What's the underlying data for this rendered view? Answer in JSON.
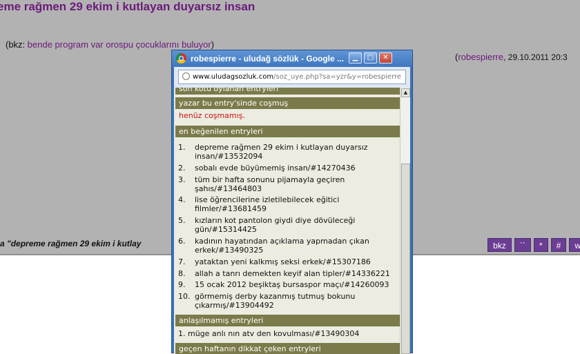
{
  "page": {
    "entry_title": "eme rağmen 29 ekim i kutlayan duyarsız insan",
    "bkz_open": "(bkz: ",
    "bkz_link": "bende program var orospu çocuklarını buluyor",
    "bkz_close": ")",
    "author_open": "(",
    "author": "robespierre",
    "author_date": ", 29.10.2011 20:3",
    "quote_fragment": "a \"depreme rağmen 29 ekim i kutlay",
    "buttons": [
      {
        "label": "bkz"
      },
      {
        "label": "``"
      },
      {
        "label": "*"
      },
      {
        "label": "#"
      },
      {
        "label": "ww"
      }
    ]
  },
  "popup": {
    "title": "robespierre - uludağ sözlük - Google ...",
    "url_host": "www.uludagsozluk.com",
    "url_path": "/soz_uye.php?sa=yzr&y=robespierre",
    "sections": {
      "cut_top": "son kötü oylanan entryleri",
      "cosmus": "yazar bu entry'sinde coşmuş",
      "cosmus_empty": "henüz coşmamış.",
      "liked": "en beğenilen entryleri",
      "unliked": "anlaşılmamış entryleri",
      "unliked_item": "1. müge anlı nın atv den kovulması/#13490304",
      "cut_bottom": "geçen haftanın dikkat çeken entryleri"
    },
    "liked_entries": [
      {
        "num": "1.",
        "line1": "depreme rağmen 29 ekim i kutlayan duyarsız",
        "line2": "insan/#13532094"
      },
      {
        "num": "2.",
        "line1": "sobalı evde büyümemiş insan/#14270436",
        "line2": ""
      },
      {
        "num": "3.",
        "line1": "tüm bir hafta sonunu pijamayla geçiren",
        "line2": "şahıs/#13464803"
      },
      {
        "num": "4.",
        "line1": "lise öğrencilerine izletilebilecek eğitici",
        "line2": "filmler/#13681459"
      },
      {
        "num": "5.",
        "line1": "kızların kot pantolon giydi diye dövüleceği",
        "line2": "gün/#15314425"
      },
      {
        "num": "6.",
        "line1": "kadının hayatından açıklama yapmadan çıkan",
        "line2": "erkek/#13490325"
      },
      {
        "num": "7.",
        "line1": "yataktan yeni kalkmış seksi erkek/#15307186",
        "line2": ""
      },
      {
        "num": "8.",
        "line1": "allah a tanrı demekten keyif alan tipler/#14336221",
        "line2": ""
      },
      {
        "num": "9.",
        "line1": "15 ocak 2012 beşiktaş bursaspor maçı/#14260093",
        "line2": ""
      },
      {
        "num": "10.",
        "line1": "görmemiş derby kazanmış tutmuş bokunu",
        "line2": "çıkarmış/#13904492"
      }
    ]
  }
}
